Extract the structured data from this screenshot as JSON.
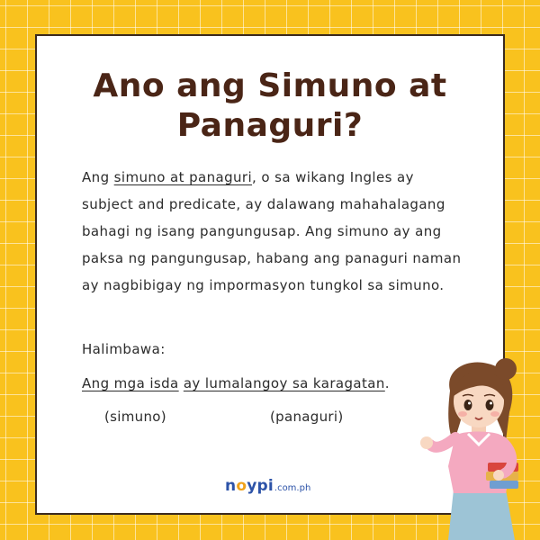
{
  "title": "Ano ang Simuno at Panaguri?",
  "paragraph": {
    "lead": "Ang ",
    "term": "simuno at panaguri",
    "rest": ", o sa wikang Ingles ay subject and predicate, ay dalawang mahahalagang bahagi ng isang pangungusap. Ang simuno ay ang paksa ng pangungusap, habang ang panaguri naman ay nagbibigay ng impormasyon tungkol sa simuno."
  },
  "example": {
    "label": "Halimbawa:",
    "subject": "Ang mga isda",
    "predicate": "ay lumalangoy sa karagatan",
    "end": ".",
    "subject_tag": "(simuno)",
    "predicate_tag": "(panaguri)"
  },
  "logo": {
    "text_before": "n",
    "text_o": "o",
    "text_after": "ypi",
    "suffix": ".com.ph"
  },
  "colors": {
    "background": "#f9c21e",
    "title": "#4a2516",
    "logo": "#2d53a8",
    "logo_accent": "#f0a21a"
  },
  "illustration": {
    "name": "teacher-illustration"
  }
}
